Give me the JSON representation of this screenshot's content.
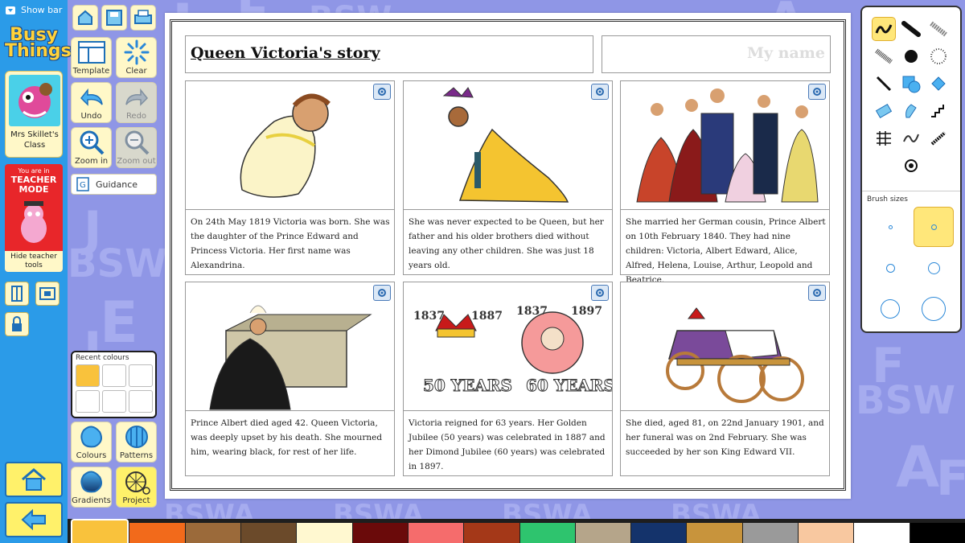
{
  "topbar": {
    "show_bar": "Show bar"
  },
  "logo": "Busy Things",
  "class_card": {
    "name": "Mrs Skillet's Class"
  },
  "teacher": {
    "you_are_in": "You are in",
    "mode": "TEACHER MODE",
    "hide": "Hide teacher tools"
  },
  "tools": {
    "template": "Template",
    "clear": "Clear",
    "undo": "Undo",
    "redo": "Redo",
    "zoom_in": "Zoom in",
    "zoom_out": "Zoom out",
    "guidance": "Guidance",
    "recent_colours": "Recent colours",
    "colours": "Colours",
    "patterns": "Patterns",
    "gradients": "Gradients",
    "project": "Project"
  },
  "sheet": {
    "title": "Queen Victoria's story",
    "name_placeholder": "My name",
    "panels": [
      {
        "caption": "On 24th May 1819 Victoria was born. She was the daughter of the Prince Edward and Princess Victoria. Her first name was Alexandrina."
      },
      {
        "caption": "She was never expected to be Queen, but her father and his older brothers died without leaving any other children. She was just 18 years old."
      },
      {
        "caption": "She married her German cousin, Prince Albert on 10th February 1840. They had nine children: Victoria, Albert Edward, Alice, Alfred, Helena, Louise, Arthur, Leopold and Beatrice."
      },
      {
        "caption": "Prince Albert died aged 42. Queen Victoria, was deeply upset by his death. She mourned him, wearing black, for rest of her life."
      },
      {
        "caption": "Victoria reigned for 63 years. Her Golden Jubilee (50 years) was celebrated in 1887 and her Dimond Jubilee (60 years) was celebrated in 1897."
      },
      {
        "caption": "She died, aged 81, on 22nd January 1901, and her funeral was on 2nd February. She was succeeded by her son King Edward VII."
      }
    ],
    "jubilee": {
      "y1": "1837",
      "y2": "1887",
      "y3": "1837",
      "y4": "1897",
      "l1": "50 YEARS",
      "l2": "60 YEARS"
    }
  },
  "brush_panel": {
    "sizes_label": "Brush sizes"
  },
  "palette": [
    "#f9c23c",
    "#f26a1b",
    "#9b6a3a",
    "#6b4a2a",
    "#fff8d0",
    "#6a0a0a",
    "#f56c6c",
    "#a43818",
    "#2ec46e",
    "#b5a58a",
    "#14336b",
    "#c8943c",
    "#9a9a9a",
    "#f8c8a0",
    "#ffffff",
    "#000000"
  ],
  "colors": {
    "accent": "#2b9be8",
    "teacher": "#e8262a",
    "button_bg": "#fff8c8"
  }
}
